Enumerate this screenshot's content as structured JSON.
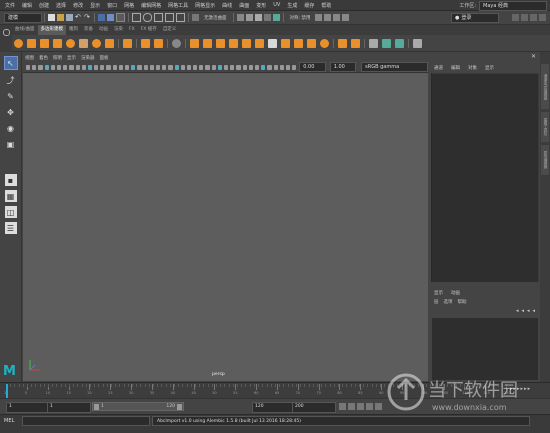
{
  "menubar": {
    "items": [
      "文件",
      "编辑",
      "创建",
      "选择",
      "修改",
      "显示",
      "窗口",
      "网格",
      "编辑网格",
      "网格工具",
      "网格显示",
      "曲线",
      "曲面",
      "变形",
      "UV",
      "生成",
      "缓存",
      "帮助"
    ],
    "workspace_label": "工作区:",
    "workspace_value": "Maya 经典"
  },
  "status": {
    "mode_dropdown": "建模",
    "no_live_surface": "无激活曲面",
    "symmetry": "对称: 禁用",
    "login": "登录"
  },
  "shelf": {
    "tabs": [
      "曲线/曲面",
      "多边形建模",
      "雕刻",
      "装备",
      "动画",
      "渲染",
      "FX",
      "FX 缓存",
      "自定义"
    ],
    "active_tab_index": 1
  },
  "viewport": {
    "menus": [
      "视图",
      "着色",
      "照明",
      "显示",
      "渲染器",
      "面板"
    ],
    "exposure": "0.00",
    "gamma": "1.00",
    "colorspace": "sRGB gamma",
    "camera_label": "persp"
  },
  "channel_box": {
    "menus": [
      "通道",
      "编辑",
      "对象",
      "显示"
    ]
  },
  "layer_editor": {
    "tabs": [
      "显示",
      "动画"
    ],
    "menus": [
      "层",
      "选项",
      "帮助"
    ]
  },
  "side_tabs": [
    "通道盒/层编辑器",
    "建模工具包",
    "属性编辑器"
  ],
  "timeline": {
    "ticks": [
      "1",
      "5",
      "10",
      "15",
      "20",
      "25",
      "30",
      "35",
      "40",
      "45",
      "50",
      "55",
      "60",
      "65",
      "70",
      "75",
      "80",
      "85",
      "90",
      "95",
      "100",
      "105",
      "110",
      "115",
      "120"
    ]
  },
  "range": {
    "start": "1",
    "playback_start": "1",
    "range_slider_start": "1",
    "range_slider_end": "120",
    "playback_end": "120",
    "end": "200"
  },
  "command": {
    "label": "MEL",
    "result": "AbcImport v1.0 using Alembic 1.5.8 (built Jul 13 2016 18:28:45)"
  },
  "watermark": {
    "title": "当下软件园",
    "url": "www.downxia.com"
  },
  "colors": {
    "accent": "#e9902a",
    "viewport_bg": "#5d5d5d",
    "maya_logo": "#1fb3c3"
  }
}
